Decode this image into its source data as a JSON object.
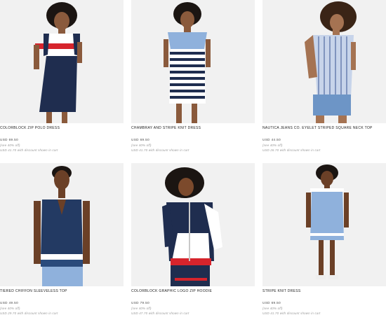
{
  "products": [
    {
      "name": "COLORBLOCK ZIP POLO DRESS",
      "price": "USD 69.50",
      "promo": "(see 40% off)",
      "discount": "USD 41.70 with discount shown in cart",
      "image_icon": "model-photo"
    },
    {
      "name": "CHAMBRAY AND STRIPE KNIT DRESS",
      "price": "USD 69.50",
      "promo": "(see 40% off)",
      "discount": "USD 41.70 with discount shown in cart",
      "image_icon": "model-photo"
    },
    {
      "name": "NAUTICA JEANS CO. EYELET STRIPED SQUARE NECK TOP",
      "price": "USD 44.50",
      "promo": "(see 40% off)",
      "discount": "USD 26.70 with discount shown in cart",
      "image_icon": "model-photo"
    },
    {
      "name": "TIERED CHIFFON SLEEVELESS TOP",
      "price": "USD 49.50",
      "promo": "(see 40% off)",
      "discount": "USD 29.70 with discount shown in cart",
      "image_icon": "model-photo"
    },
    {
      "name": "COLORBLOCK GRAPHIC LOGO ZIP HOODIE",
      "price": "USD 79.50",
      "promo": "(see 40% off)",
      "discount": "USD 47.70 with discount shown in cart",
      "image_icon": "model-photo"
    },
    {
      "name": "STRIPE KNIT DRESS",
      "price": "USD 69.50",
      "promo": "(see 40% off)",
      "discount": "USD 41.70 with discount shown in cart",
      "image_icon": "model-photo"
    }
  ],
  "colors": {
    "navy": "#1f2d4f",
    "red": "#d6242c",
    "light_blue": "#8fb1dc",
    "photo_bg": "#f1f1f1"
  }
}
